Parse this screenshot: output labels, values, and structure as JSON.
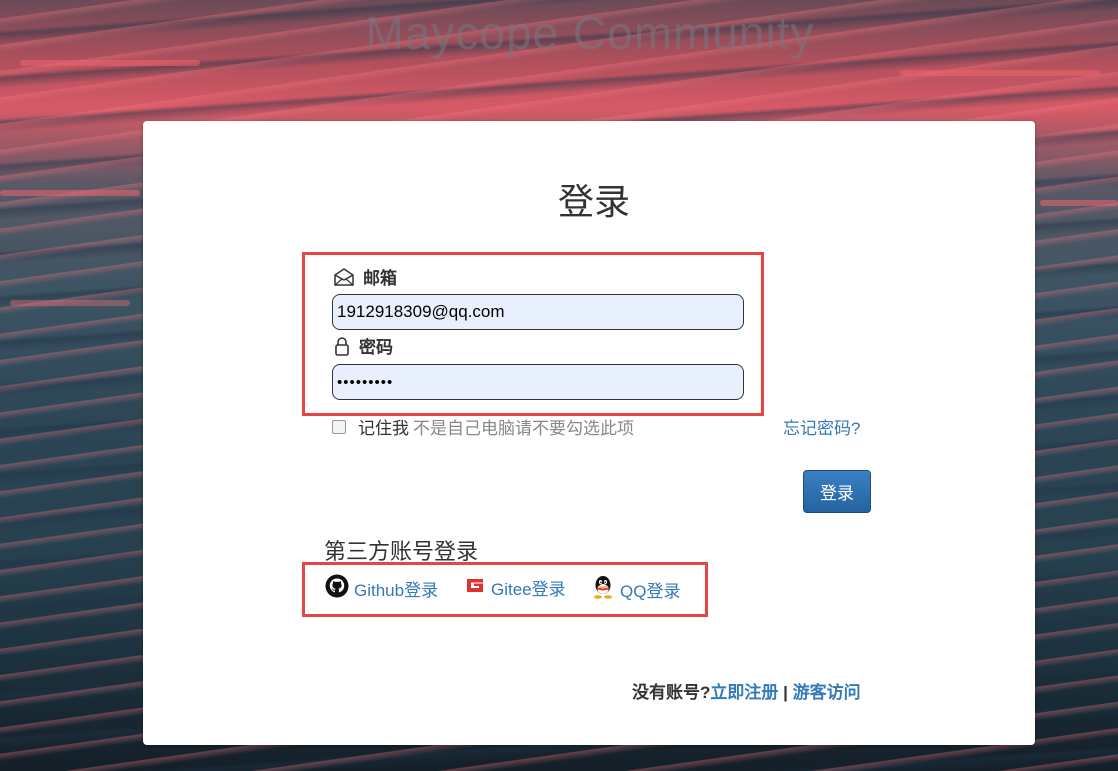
{
  "site": {
    "title": "Maycope Community"
  },
  "login": {
    "title": "登录",
    "email": {
      "label": "邮箱",
      "value": "1912918309@qq.com",
      "icon": "envelope-icon"
    },
    "password": {
      "label": "密码",
      "value": "•••••••••",
      "icon": "lock-icon"
    },
    "remember": {
      "label": "记住我",
      "hint": "不是自己电脑请不要勾选此项",
      "checked": false
    },
    "forgot_label": "忘记密码?",
    "submit_label": "登录"
  },
  "third_party": {
    "title": "第三方账号登录",
    "providers": [
      {
        "label": "Github登录",
        "icon": "github-icon"
      },
      {
        "label": "Gitee登录",
        "icon": "gitee-icon"
      },
      {
        "label": "QQ登录",
        "icon": "qq-icon"
      }
    ]
  },
  "footer": {
    "prompt": "没有账号?",
    "register_label": "立即注册",
    "separator": "|",
    "guest_label": "游客访问"
  },
  "colors": {
    "accent": "#337ab7",
    "button": "#2463a0",
    "highlight_border": "#e64545",
    "input_bg": "#e8f0fe",
    "gitee_red": "#e03131"
  }
}
